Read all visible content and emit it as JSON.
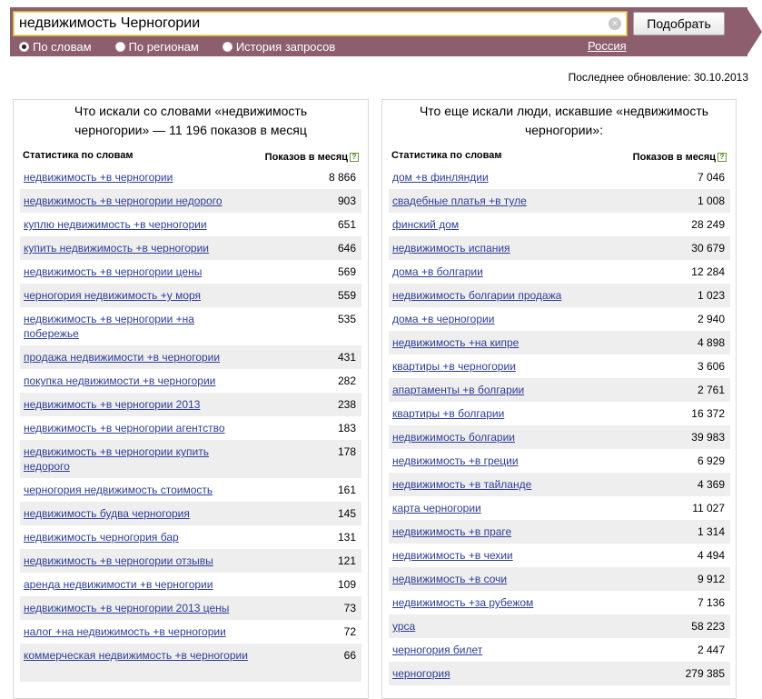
{
  "search": {
    "query": "недвижимость Черногории",
    "submit_label": "Подобрать",
    "clear_glyph": "×",
    "modes": [
      {
        "label": "По словам",
        "selected": true
      },
      {
        "label": "По регионам",
        "selected": false
      },
      {
        "label": "История запросов",
        "selected": false
      }
    ],
    "region": "Россия"
  },
  "last_update": "Последнее обновление: 30.10.2013",
  "left": {
    "title": "Что искали со словами «недвижимость черногории» — 11 196 показов в месяц",
    "col_name": "Статистика по словам",
    "col_count": "Показов в месяц",
    "help": "?",
    "rows": [
      {
        "text": "недвижимость +в черногории",
        "count": "8 866"
      },
      {
        "text": "недвижимость +в черногории недорого",
        "count": "903"
      },
      {
        "text": "куплю недвижимость +в черногории",
        "count": "651"
      },
      {
        "text": "купить недвижимость +в черногории",
        "count": "646"
      },
      {
        "text": "недвижимость +в черногории цены",
        "count": "569"
      },
      {
        "text": "черногория недвижимость +у моря",
        "count": "559"
      },
      {
        "text": "недвижимость +в черногории +на побережье",
        "count": "535"
      },
      {
        "text": "продажа недвижимости +в черногории",
        "count": "431"
      },
      {
        "text": "покупка недвижимости +в черногории",
        "count": "282"
      },
      {
        "text": "недвижимость +в черногории 2013",
        "count": "238"
      },
      {
        "text": "недвижимость +в черногории агентство",
        "count": "183"
      },
      {
        "text": "недвижимость +в черногории купить недорого",
        "count": "178"
      },
      {
        "text": "черногория недвижимость стоимость",
        "count": "161"
      },
      {
        "text": "недвижимость будва черногория",
        "count": "145"
      },
      {
        "text": "недвижимость черногория бар",
        "count": "131"
      },
      {
        "text": "недвижимость +в черногории отзывы",
        "count": "121"
      },
      {
        "text": "аренда недвижимости +в черногории",
        "count": "109"
      },
      {
        "text": "недвижимость +в черногории 2013 цены",
        "count": "73"
      },
      {
        "text": "налог +на недвижимость +в черногории",
        "count": "72"
      },
      {
        "text": "коммерческая недвижимость +в черногории",
        "count": "66"
      }
    ]
  },
  "right": {
    "title": "Что еще искали люди, искавшие «недвижимость черногории»:",
    "col_name": "Статистика по словам",
    "col_count": "Показов в месяц",
    "help": "?",
    "rows": [
      {
        "text": "дом +в финляндии",
        "count": "7 046"
      },
      {
        "text": "свадебные платья +в туле",
        "count": "1 008"
      },
      {
        "text": "финский дом",
        "count": "28 249"
      },
      {
        "text": "недвижимость испания",
        "count": "30 679"
      },
      {
        "text": "дома +в болгарии",
        "count": "12 284"
      },
      {
        "text": "недвижимость болгарии продажа",
        "count": "1 023"
      },
      {
        "text": "дома +в черногории",
        "count": "2 940"
      },
      {
        "text": "недвижимость +на кипре",
        "count": "4 898"
      },
      {
        "text": "квартиры +в черногории",
        "count": "3 606"
      },
      {
        "text": "апартаменты +в болгарии",
        "count": "2 761"
      },
      {
        "text": "квартиры +в болгарии",
        "count": "16 372"
      },
      {
        "text": "недвижимость болгарии",
        "count": "39 983"
      },
      {
        "text": "недвижимость +в греции",
        "count": "6 929"
      },
      {
        "text": "недвижимость +в тайланде",
        "count": "4 369"
      },
      {
        "text": "карта черногории",
        "count": "11 027"
      },
      {
        "text": "недвижимость +в праге",
        "count": "1 314"
      },
      {
        "text": "недвижимость +в чехии",
        "count": "4 494"
      },
      {
        "text": "недвижимость +в сочи",
        "count": "9 912"
      },
      {
        "text": "недвижимость +за рубежом",
        "count": "7 136"
      },
      {
        "text": "урса",
        "count": "58 223"
      },
      {
        "text": "черногория билет",
        "count": "2 447"
      },
      {
        "text": "черногория",
        "count": "279 385"
      }
    ]
  }
}
